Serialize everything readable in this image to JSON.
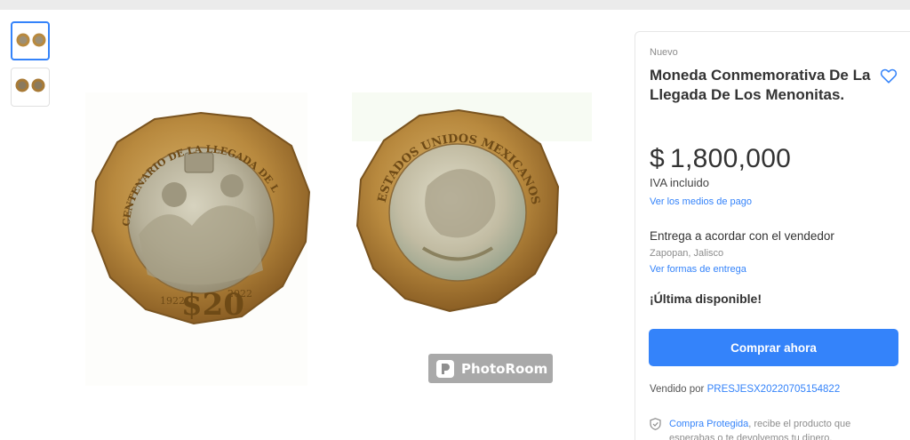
{
  "gallery": {
    "watermark": "PhotoRoom",
    "year_left": "1922",
    "year_right": "2022",
    "denomination": "$20",
    "obverse_legend": "ESTADOS UNIDOS MEXICANOS"
  },
  "product": {
    "condition": "Nuevo",
    "title": "Moneda Conmemorativa De La Llegada De Los Menonitas.",
    "price_currency": "$",
    "price_amount": "1,800,000",
    "iva": "IVA incluido",
    "payment_link": "Ver los medios de pago",
    "delivery": "Entrega a acordar con el vendedor",
    "location": "Zapopan, Jalisco",
    "delivery_link": "Ver formas de entrega",
    "stock": "¡Última disponible!",
    "buy_label": "Comprar ahora",
    "seller_prefix": "Vendido por",
    "seller_name": "PRESJESX20220705154822",
    "protect_link": "Compra Protegida",
    "protect_text": ", recibe el producto que esperabas o te devolvemos tu dinero."
  },
  "colors": {
    "accent": "#3483fa",
    "coin_gold": "#b8893e",
    "coin_center": "#b9b39c"
  },
  "icons": {
    "favorite": "heart-outline-icon",
    "protect": "shield-check-icon",
    "watermark": "photoroom-logo-icon"
  }
}
